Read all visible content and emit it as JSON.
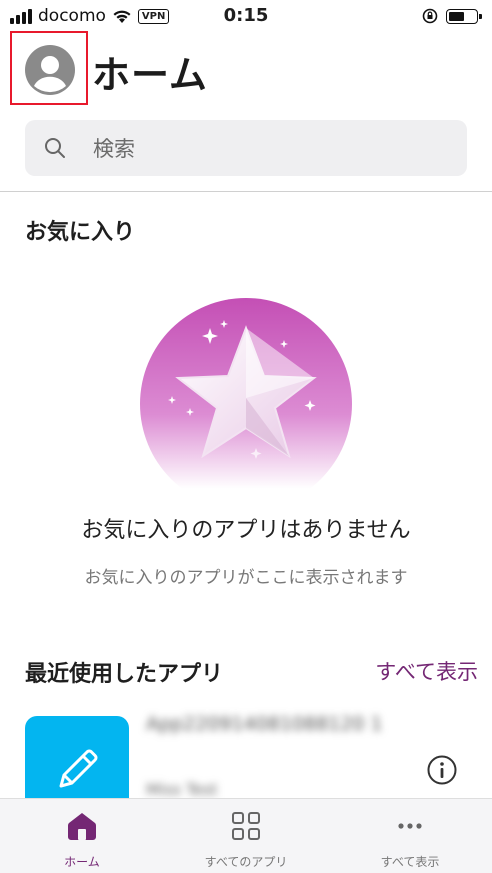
{
  "status_bar": {
    "carrier": "docomo",
    "vpn": "VPN",
    "time": "0:15"
  },
  "header": {
    "title": "ホーム"
  },
  "search": {
    "placeholder": "検索"
  },
  "favorites": {
    "section_title": "お気に入り",
    "empty_title": "お気に入りのアプリはありません",
    "empty_subtitle": "お気に入りのアプリがここに表示されます"
  },
  "recent": {
    "section_title": "最近使用したアプリ",
    "show_all_label": "すべて表示",
    "apps": [
      {
        "name": "App220914081088120 1",
        "owner": "Miss Test"
      }
    ]
  },
  "tabs": [
    {
      "label": "ホーム",
      "icon": "home-icon",
      "active": true
    },
    {
      "label": "すべてのアプリ",
      "icon": "grid-icon",
      "active": false
    },
    {
      "label": "すべて表示",
      "icon": "more-icon",
      "active": false
    }
  ],
  "colors": {
    "accent": "#742774",
    "app_tile": "#03b5f0",
    "highlight_box": "#e8192c"
  }
}
